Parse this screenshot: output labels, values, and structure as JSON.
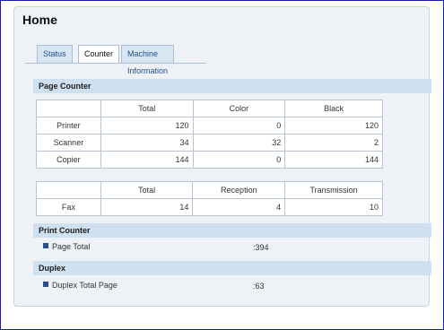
{
  "page": {
    "title": "Home"
  },
  "tabs": [
    {
      "label": "Status",
      "active": false
    },
    {
      "label": "Counter",
      "active": true
    },
    {
      "label": "Machine Information",
      "active": false
    }
  ],
  "page_counter": {
    "header": "Page Counter",
    "table1": {
      "columns": [
        "",
        "Total",
        "Color",
        "Black"
      ],
      "rows": [
        {
          "label": "Printer",
          "total": "120",
          "color": "0",
          "black": "120"
        },
        {
          "label": "Scanner",
          "total": "34",
          "color": "32",
          "black": "2"
        },
        {
          "label": "Copier",
          "total": "144",
          "color": "0",
          "black": "144"
        }
      ]
    },
    "table2": {
      "columns": [
        "",
        "Total",
        "Reception",
        "Transmission"
      ],
      "rows": [
        {
          "label": "Fax",
          "total": "14",
          "reception": "4",
          "transmission": "10"
        }
      ]
    }
  },
  "print_counter": {
    "header": "Print Counter",
    "item_label": "Page Total",
    "item_value": ":394"
  },
  "duplex": {
    "header": "Duplex",
    "item_label": "Duplex Total Page",
    "item_value": ":63"
  },
  "colors": {
    "section_header_bg": "#cfe0f1",
    "tab_bg": "#d8e6f3",
    "frame_border": "#1a1aa8"
  }
}
